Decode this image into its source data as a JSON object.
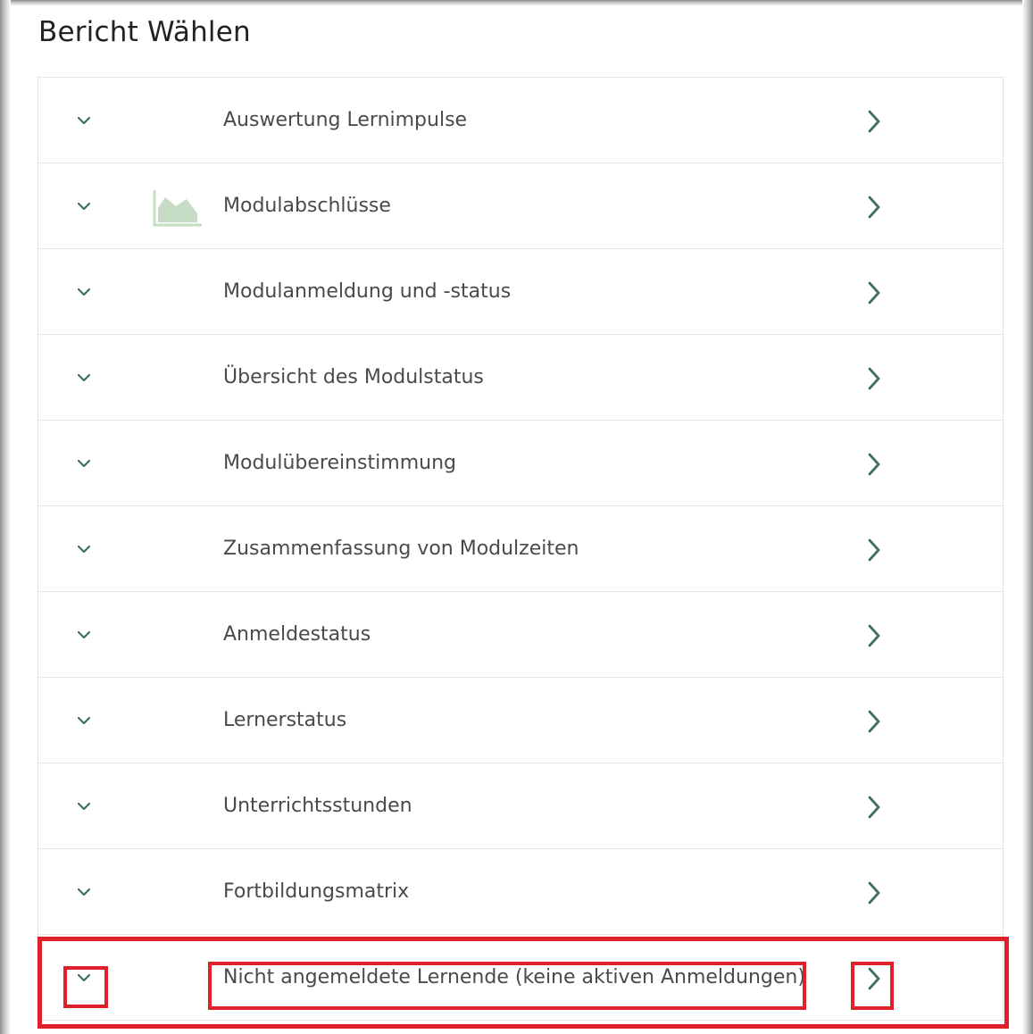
{
  "page": {
    "title": "Bericht Wählen"
  },
  "reports": [
    {
      "label": "Auswertung Lernimpulse",
      "icon": "none"
    },
    {
      "label": "Modulabschlüsse",
      "icon": "area-chart-icon"
    },
    {
      "label": "Modulanmeldung und -status",
      "icon": "none"
    },
    {
      "label": "Übersicht des Modulstatus",
      "icon": "none"
    },
    {
      "label": "Modulübereinstimmung",
      "icon": "none"
    },
    {
      "label": "Zusammenfassung von Modulzeiten",
      "icon": "none"
    },
    {
      "label": "Anmeldestatus",
      "icon": "none"
    },
    {
      "label": "Lernerstatus",
      "icon": "none"
    },
    {
      "label": "Unterrichtsstunden",
      "icon": "none"
    },
    {
      "label": "Fortbildungsmatrix",
      "icon": "none"
    },
    {
      "label": "Nicht angemeldete Lernende (keine aktiven Anmeldungen)",
      "icon": "none",
      "highlighted": true
    }
  ],
  "colors": {
    "chevron": "#3f6e68",
    "label": "#4a4a4a",
    "area_icon": "#c7dcc4",
    "highlight": "#e0212b",
    "divider": "#e3e3e3"
  },
  "icons": {
    "expand": "chevron-down-icon",
    "open": "chevron-right-icon"
  }
}
